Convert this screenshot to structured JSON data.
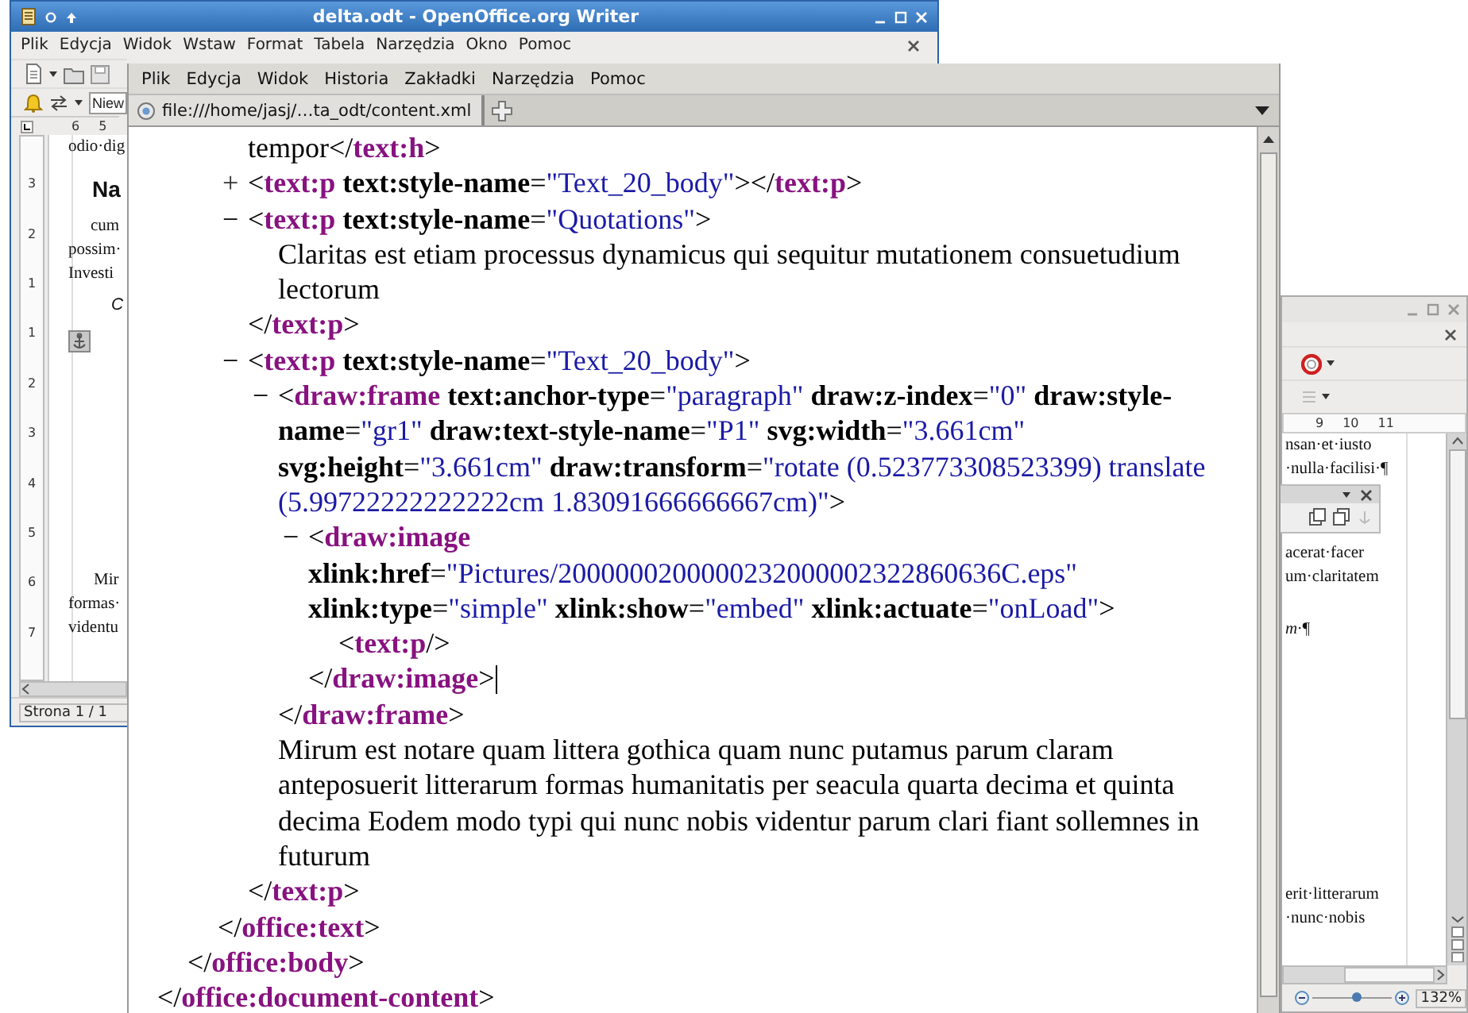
{
  "writer_window": {
    "title": "delta.odt - OpenOffice.org Writer",
    "menu": [
      "Plik",
      "Edycja",
      "Widok",
      "Wstaw",
      "Format",
      "Tabela",
      "Narzędzia",
      "Okno",
      "Pomoc"
    ],
    "style_box": "Niew",
    "ruler_numbers": [
      "6",
      "5"
    ],
    "vertical_ruler_numbers": [
      "3",
      "2",
      "1",
      "1",
      "2",
      "3",
      "4",
      "5",
      "6",
      "7"
    ],
    "paragraphs": [
      {
        "kind": "body",
        "anchor": false,
        "lines": [
          "odio·dig"
        ]
      },
      {
        "kind": "heading",
        "anchor": false,
        "lines": [
          "Na"
        ]
      },
      {
        "kind": "body",
        "anchor": false,
        "lines": [
          "cum",
          "possim·",
          "Investi"
        ]
      },
      {
        "kind": "quote",
        "anchor": false,
        "lines": [
          "C"
        ]
      },
      {
        "kind": "body",
        "anchor": true,
        "lines": [
          "Mir",
          "formas·",
          "videntu"
        ]
      }
    ],
    "status": "Strona 1 / 1"
  },
  "writer_window_2": {
    "ruler_numbers": [
      "9",
      "10",
      "11"
    ],
    "paragraphs": [
      {
        "kind": "body",
        "lines": [
          "nsan·et·iusto",
          "·nulla·facilisi·¶"
        ]
      },
      {
        "kind": "body",
        "lines": [
          "acerat·facer",
          "um·claritatem"
        ]
      },
      {
        "kind": "quote",
        "lines": [
          "m·¶"
        ]
      },
      {
        "kind": "body",
        "lines": [
          "erit·litterarum",
          "·nunc·nobis"
        ]
      }
    ],
    "zoom_slider": {
      "level": 0.55
    },
    "zoom": "132%"
  },
  "browser_window": {
    "menu": [
      "Plik",
      "Edycja",
      "Widok",
      "Historia",
      "Zakładki",
      "Narzędzia",
      "Pomoc"
    ],
    "tabs": [
      {
        "label": "file:///home/jasj/…ta_odt/content.xml",
        "selected": true
      }
    ],
    "xml_tree": [
      {
        "kind": "element",
        "end": [
          {
            "kind": "punct",
            "t": "</"
          },
          {
            "kind": "tag",
            "t": "office:document-content"
          },
          {
            "kind": "punct",
            "t": ">"
          }
        ],
        "children": [
          {
            "kind": "element",
            "end": [
              {
                "kind": "punct",
                "t": "</"
              },
              {
                "kind": "tag",
                "t": "office:body"
              },
              {
                "kind": "punct",
                "t": ">"
              }
            ],
            "children": [
              {
                "kind": "element",
                "end": [
                  {
                    "kind": "punct",
                    "t": "</"
                  },
                  {
                    "kind": "tag",
                    "t": "office:text"
                  },
                  {
                    "kind": "punct",
                    "t": ">"
                  }
                ],
                "children": [
                  {
                    "kind": "line",
                    "tokens": [
                      {
                        "kind": "text",
                        "t": "tempor"
                      },
                      {
                        "kind": "punct",
                        "t": "</"
                      },
                      {
                        "kind": "tag",
                        "t": "text:h"
                      },
                      {
                        "kind": "punct",
                        "t": ">"
                      }
                    ]
                  },
                  {
                    "kind": "element",
                    "toggle": "+",
                    "expanded": false,
                    "start": [
                      {
                        "kind": "punct",
                        "t": "<"
                      },
                      {
                        "kind": "tag",
                        "t": "text:p"
                      },
                      {
                        "kind": "attr",
                        "t": " text:style-name"
                      },
                      {
                        "kind": "punct",
                        "t": "="
                      },
                      {
                        "kind": "value",
                        "t": "\"Text_20_body\""
                      },
                      {
                        "kind": "punct",
                        "t": ">"
                      }
                    ],
                    "end": [
                      {
                        "kind": "punct",
                        "t": "</"
                      },
                      {
                        "kind": "tag",
                        "t": "text:p"
                      },
                      {
                        "kind": "punct",
                        "t": ">"
                      }
                    ]
                  },
                  {
                    "kind": "element",
                    "toggle": "−",
                    "expanded": true,
                    "start": [
                      {
                        "kind": "punct",
                        "t": "<"
                      },
                      {
                        "kind": "tag",
                        "t": "text:p"
                      },
                      {
                        "kind": "attr",
                        "t": " text:style-name"
                      },
                      {
                        "kind": "punct",
                        "t": "="
                      },
                      {
                        "kind": "value",
                        "t": "\"Quotations\""
                      },
                      {
                        "kind": "punct",
                        "t": ">"
                      }
                    ],
                    "end": [
                      {
                        "kind": "punct",
                        "t": "</"
                      },
                      {
                        "kind": "tag",
                        "t": "text:p"
                      },
                      {
                        "kind": "punct",
                        "t": ">"
                      }
                    ],
                    "children": [
                      {
                        "kind": "text",
                        "text": "Claritas est etiam processus dynamicus qui sequitur mutationem consuetudium lectorum"
                      }
                    ]
                  },
                  {
                    "kind": "element",
                    "toggle": "−",
                    "expanded": true,
                    "start": [
                      {
                        "kind": "punct",
                        "t": "<"
                      },
                      {
                        "kind": "tag",
                        "t": "text:p"
                      },
                      {
                        "kind": "attr",
                        "t": " text:style-name"
                      },
                      {
                        "kind": "punct",
                        "t": "="
                      },
                      {
                        "kind": "value",
                        "t": "\"Text_20_body\""
                      },
                      {
                        "kind": "punct",
                        "t": ">"
                      }
                    ],
                    "end": [
                      {
                        "kind": "punct",
                        "t": "</"
                      },
                      {
                        "kind": "tag",
                        "t": "text:p"
                      },
                      {
                        "kind": "punct",
                        "t": ">"
                      }
                    ],
                    "children": [
                      {
                        "kind": "element",
                        "toggle": "−",
                        "expanded": true,
                        "start": [
                          {
                            "kind": "punct",
                            "t": "<"
                          },
                          {
                            "kind": "tag",
                            "t": "draw:frame"
                          },
                          {
                            "kind": "attr",
                            "t": " text:anchor-type"
                          },
                          {
                            "kind": "punct",
                            "t": "="
                          },
                          {
                            "kind": "value",
                            "t": "\"paragraph\""
                          },
                          {
                            "kind": "attr",
                            "t": " draw:z-index"
                          },
                          {
                            "kind": "punct",
                            "t": "="
                          },
                          {
                            "kind": "value",
                            "t": "\"0\""
                          },
                          {
                            "kind": "attr",
                            "t": " draw:style-name"
                          },
                          {
                            "kind": "punct",
                            "t": "="
                          },
                          {
                            "kind": "value",
                            "t": "\"gr1\""
                          },
                          {
                            "kind": "attr",
                            "t": " draw:text-style-name"
                          },
                          {
                            "kind": "punct",
                            "t": "="
                          },
                          {
                            "kind": "value",
                            "t": "\"P1\""
                          },
                          {
                            "kind": "attr",
                            "t": " svg:width"
                          },
                          {
                            "kind": "punct",
                            "t": "="
                          },
                          {
                            "kind": "value",
                            "t": "\"3.661cm\""
                          },
                          {
                            "kind": "attr",
                            "t": " svg:height"
                          },
                          {
                            "kind": "punct",
                            "t": "="
                          },
                          {
                            "kind": "value",
                            "t": "\"3.661cm\""
                          },
                          {
                            "kind": "attr",
                            "t": " draw:transform"
                          },
                          {
                            "kind": "punct",
                            "t": "="
                          },
                          {
                            "kind": "value",
                            "t": "\"rotate (0.523773308523399) translate (5.99722222222222cm 1.83091666666667cm)\""
                          },
                          {
                            "kind": "punct",
                            "t": ">"
                          }
                        ],
                        "end": [
                          {
                            "kind": "punct",
                            "t": "</"
                          },
                          {
                            "kind": "tag",
                            "t": "draw:frame"
                          },
                          {
                            "kind": "punct",
                            "t": ">"
                          }
                        ],
                        "children": [
                          {
                            "kind": "element",
                            "toggle": "−",
                            "expanded": true,
                            "caret": true,
                            "start": [
                              {
                                "kind": "punct",
                                "t": "<"
                              },
                              {
                                "kind": "tag",
                                "t": "draw:image"
                              },
                              {
                                "kind": "attr",
                                "t": " xlink:href"
                              },
                              {
                                "kind": "punct",
                                "t": "="
                              },
                              {
                                "kind": "value",
                                "t": "\"Pictures/2000000200000232000002322860636C.eps\""
                              },
                              {
                                "kind": "attr",
                                "t": " xlink:type"
                              },
                              {
                                "kind": "punct",
                                "t": "="
                              },
                              {
                                "kind": "value",
                                "t": "\"simple\""
                              },
                              {
                                "kind": "attr",
                                "t": " xlink:show"
                              },
                              {
                                "kind": "punct",
                                "t": "="
                              },
                              {
                                "kind": "value",
                                "t": "\"embed\""
                              },
                              {
                                "kind": "attr",
                                "t": " xlink:actuate"
                              },
                              {
                                "kind": "punct",
                                "t": "="
                              },
                              {
                                "kind": "value",
                                "t": "\"onLoad\""
                              },
                              {
                                "kind": "punct",
                                "t": ">"
                              }
                            ],
                            "end": [
                              {
                                "kind": "punct",
                                "t": "</"
                              },
                              {
                                "kind": "tag",
                                "t": "draw:image"
                              },
                              {
                                "kind": "punct",
                                "t": ">"
                              }
                            ],
                            "children": [
                              {
                                "kind": "line",
                                "tokens": [
                                  {
                                    "kind": "punct",
                                    "t": "<"
                                  },
                                  {
                                    "kind": "tag",
                                    "t": "text:p"
                                  },
                                  {
                                    "kind": "punct",
                                    "t": "/>"
                                  }
                                ]
                              }
                            ]
                          }
                        ]
                      },
                      {
                        "kind": "text",
                        "text": "Mirum est notare quam littera gothica quam nunc putamus parum claram anteposuerit litterarum formas humanitatis per seacula quarta decima et quinta decima Eodem modo typi qui nunc nobis videntur parum clari fiant sollemnes in futurum"
                      }
                    ]
                  }
                ]
              }
            ]
          }
        ]
      }
    ]
  }
}
